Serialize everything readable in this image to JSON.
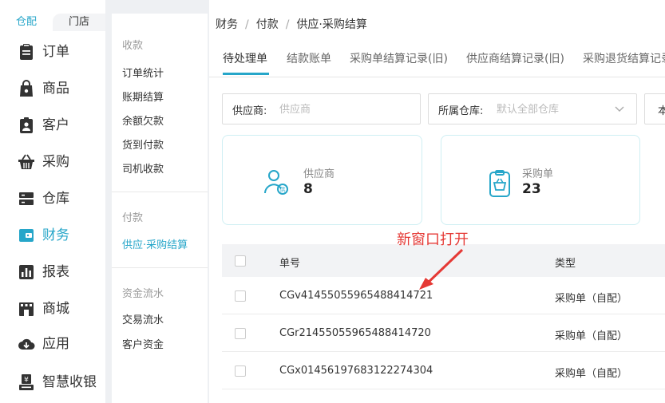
{
  "nav": {
    "tabs": [
      "仓配",
      "门店"
    ],
    "items": [
      {
        "label": "订单",
        "icon": "clipboard-icon"
      },
      {
        "label": "商品",
        "icon": "shopping-bag-icon"
      },
      {
        "label": "客户",
        "icon": "customer-badge-icon"
      },
      {
        "label": "采购",
        "icon": "basket-icon"
      },
      {
        "label": "仓库",
        "icon": "server-icon"
      },
      {
        "label": "财务",
        "icon": "wallet-icon"
      },
      {
        "label": "报表",
        "icon": "bar-chart-icon"
      },
      {
        "label": "商城",
        "icon": "storefront-icon"
      },
      {
        "label": "应用",
        "icon": "cloud-download-icon"
      },
      {
        "label": "智慧收银",
        "icon": "cash-register-icon"
      }
    ],
    "active_index": 5
  },
  "subnav": {
    "sections": [
      {
        "heading": "收款",
        "items": [
          "订单统计",
          "账期结算",
          "余额欠款",
          "货到付款",
          "司机收款"
        ]
      },
      {
        "heading": "付款",
        "items": [
          "供应·采购结算"
        ]
      },
      {
        "heading": "资金流水",
        "items": [
          "交易流水",
          "客户资金"
        ]
      }
    ],
    "active_item": "供应·采购结算"
  },
  "breadcrumb": [
    "财务",
    "付款",
    "供应·采购结算"
  ],
  "tabs": [
    "待处理单",
    "结款账单",
    "采购单结算记录(旧)",
    "供应商结算记录(旧)",
    "采购退货结算记录"
  ],
  "filters": {
    "supplier_label": "供应商:",
    "supplier_placeholder": "供应商",
    "warehouse_label": "所属仓库:",
    "warehouse_placeholder": "默认全部仓库",
    "button_label": "本"
  },
  "cards": [
    {
      "label": "供应商",
      "value": "8",
      "icon": "supplier-icon"
    },
    {
      "label": "采购单",
      "value": "23",
      "icon": "purchase-order-icon"
    }
  ],
  "annotation": "新窗口打开",
  "colors": {
    "accent": "#26a6c9",
    "annotation": "#e53935"
  },
  "table": {
    "headers": [
      "单号",
      "类型"
    ],
    "rows": [
      {
        "id": "CGv41455055965488414721",
        "type": "采购单（自配）"
      },
      {
        "id": "CGr21455055965488414720",
        "type": "采购单（自配）"
      },
      {
        "id": "CGx01456197683122274304",
        "type": "采购单（自配）"
      }
    ]
  }
}
